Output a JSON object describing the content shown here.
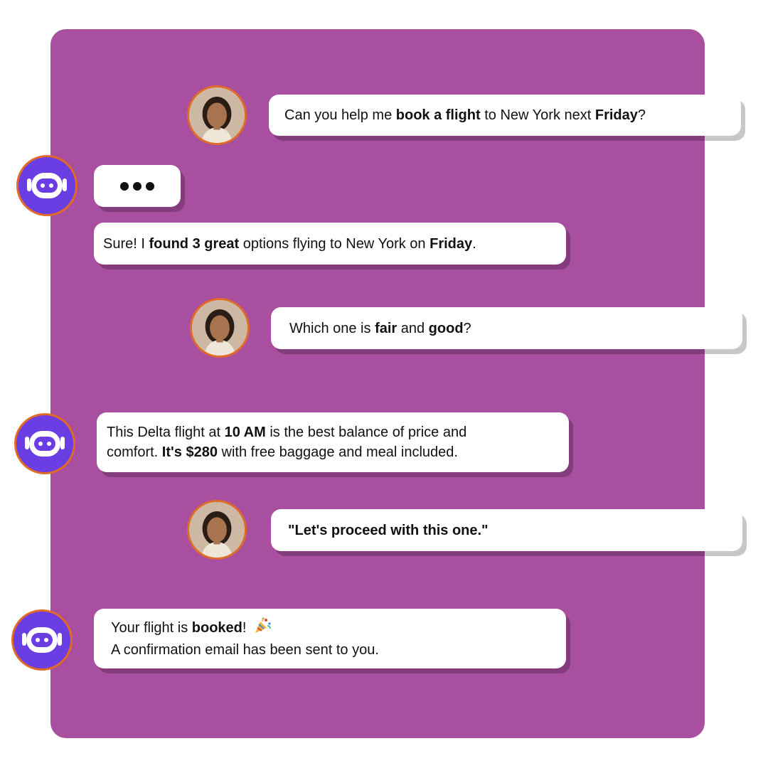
{
  "colors": {
    "panel": "#a94f9f",
    "bubble": "#ffffff",
    "bot_avatar": "#6a3ee3",
    "avatar_ring": "#e06a28",
    "text": "#111111"
  },
  "messages": [
    {
      "sender": "user",
      "avatar_icon": "user-photo-avatar",
      "lines": [
        [
          {
            "t": "Can you help me ",
            "b": false
          },
          {
            "t": "book a flight",
            "b": true
          },
          {
            "t": " to New York next ",
            "b": false
          },
          {
            "t": "Friday",
            "b": true
          },
          {
            "t": "?",
            "b": false
          }
        ]
      ]
    },
    {
      "sender": "bot",
      "avatar_icon": "robot-icon",
      "typing": true,
      "typing_icon": "typing-dots-icon"
    },
    {
      "sender": "bot",
      "lines": [
        [
          {
            "t": "Sure! I ",
            "b": false
          },
          {
            "t": "found 3 great",
            "b": true
          },
          {
            "t": " options flying to New York on ",
            "b": false
          },
          {
            "t": "Friday",
            "b": true
          },
          {
            "t": ".",
            "b": false
          }
        ]
      ]
    },
    {
      "sender": "user",
      "avatar_icon": "user-photo-avatar",
      "lines": [
        [
          {
            "t": "Which one is ",
            "b": false
          },
          {
            "t": "fair",
            "b": true
          },
          {
            "t": " and ",
            "b": false
          },
          {
            "t": "good",
            "b": true
          },
          {
            "t": "?",
            "b": false
          }
        ]
      ]
    },
    {
      "sender": "bot",
      "avatar_icon": "robot-icon",
      "lines": [
        [
          {
            "t": "This Delta flight at ",
            "b": false
          },
          {
            "t": "10 AM",
            "b": true
          },
          {
            "t": " is the best balance of price and",
            "b": false
          }
        ],
        [
          {
            "t": "comfort. ",
            "b": false
          },
          {
            "t": "It's $280",
            "b": true
          },
          {
            "t": " with free baggage and meal included.",
            "b": false
          }
        ]
      ]
    },
    {
      "sender": "user",
      "avatar_icon": "user-photo-avatar",
      "lines": [
        [
          {
            "t": "\"Let's proceed with this one.\"",
            "b": true
          }
        ]
      ]
    },
    {
      "sender": "bot",
      "avatar_icon": "robot-icon",
      "emoji_icon": "party-popper-icon",
      "lines": [
        [
          {
            "t": "Your flight is ",
            "b": false
          },
          {
            "t": "booked",
            "b": true
          },
          {
            "t": "! ",
            "b": false
          }
        ],
        [
          {
            "t": "A confirmation email has been sent to you.",
            "b": false
          }
        ]
      ]
    }
  ]
}
